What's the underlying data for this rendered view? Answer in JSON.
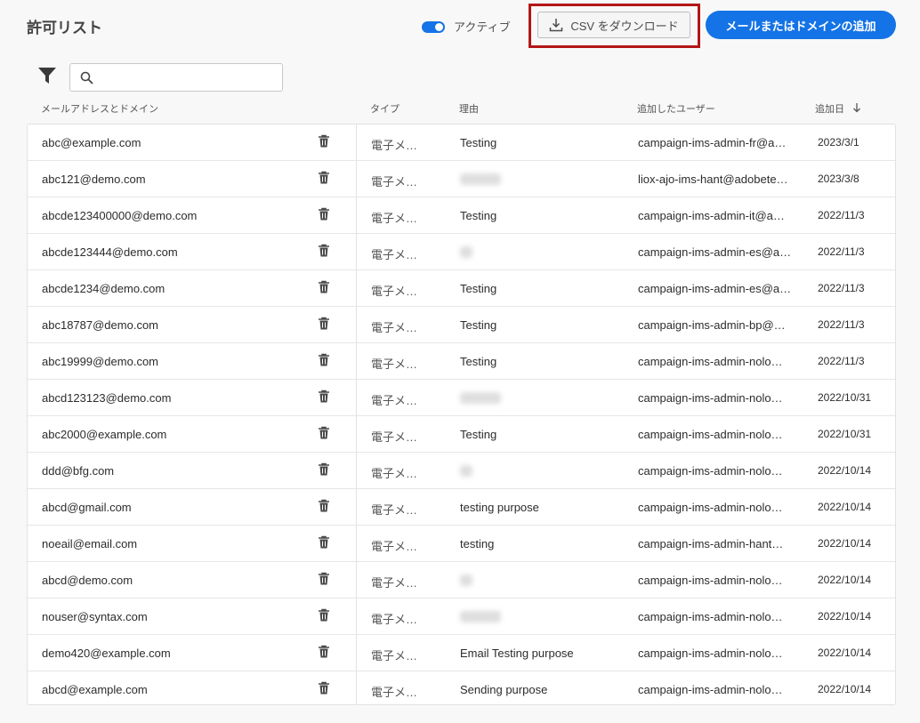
{
  "header": {
    "title": "許可リスト",
    "toggle_label": "アクティブ",
    "toggle_on": true,
    "download_label": "CSV をダウンロード",
    "add_label": "メールまたはドメインの追加"
  },
  "search": {
    "value": "",
    "placeholder": ""
  },
  "columns": {
    "email": "メールアドレスとドメイン",
    "type": "タイプ",
    "reason": "理由",
    "user": "追加したユーザー",
    "date": "追加日"
  },
  "rows": [
    {
      "email": "abc@example.com",
      "type": "電子メ…",
      "reason": "Testing",
      "user": "campaign-ims-admin-fr@a…",
      "date": "2023/3/1"
    },
    {
      "email": "abc121@demo.com",
      "type": "電子メ…",
      "reason": "",
      "user": "liox-ajo-ims-hant@adobete…",
      "date": "2023/3/8"
    },
    {
      "email": "abcde123400000@demo.com",
      "type": "電子メ…",
      "reason": "Testing",
      "user": "campaign-ims-admin-it@a…",
      "date": "2022/11/3"
    },
    {
      "email": "abcde123444@demo.com",
      "type": "電子メ…",
      "reason": "",
      "user": "campaign-ims-admin-es@a…",
      "date": "2022/11/3"
    },
    {
      "email": "abcde1234@demo.com",
      "type": "電子メ…",
      "reason": "Testing",
      "user": "campaign-ims-admin-es@a…",
      "date": "2022/11/3"
    },
    {
      "email": "abc18787@demo.com",
      "type": "電子メ…",
      "reason": "Testing",
      "user": "campaign-ims-admin-bp@…",
      "date": "2022/11/3"
    },
    {
      "email": "abc19999@demo.com",
      "type": "電子メ…",
      "reason": "Testing",
      "user": "campaign-ims-admin-nolo…",
      "date": "2022/11/3"
    },
    {
      "email": "abcd123123@demo.com",
      "type": "電子メ…",
      "reason": "",
      "user": "campaign-ims-admin-nolo…",
      "date": "2022/10/31"
    },
    {
      "email": "abc2000@example.com",
      "type": "電子メ…",
      "reason": "Testing",
      "user": "campaign-ims-admin-nolo…",
      "date": "2022/10/31"
    },
    {
      "email": "ddd@bfg.com",
      "type": "電子メ…",
      "reason": "",
      "user": "campaign-ims-admin-nolo…",
      "date": "2022/10/14"
    },
    {
      "email": "abcd@gmail.com",
      "type": "電子メ…",
      "reason": "testing purpose",
      "user": "campaign-ims-admin-nolo…",
      "date": "2022/10/14"
    },
    {
      "email": "noeail@email.com",
      "type": "電子メ…",
      "reason": "testing",
      "user": "campaign-ims-admin-hant…",
      "date": "2022/10/14"
    },
    {
      "email": "abcd@demo.com",
      "type": "電子メ…",
      "reason": "",
      "user": "campaign-ims-admin-nolo…",
      "date": "2022/10/14"
    },
    {
      "email": "nouser@syntax.com",
      "type": "電子メ…",
      "reason": "",
      "user": "campaign-ims-admin-nolo…",
      "date": "2022/10/14"
    },
    {
      "email": "demo420@example.com",
      "type": "電子メ…",
      "reason": "Email Testing purpose",
      "user": "campaign-ims-admin-nolo…",
      "date": "2022/10/14"
    },
    {
      "email": "abcd@example.com",
      "type": "電子メ…",
      "reason": "Sending purpose",
      "user": "campaign-ims-admin-nolo…",
      "date": "2022/10/14"
    }
  ],
  "colors": {
    "accent": "#1473e6",
    "highlight": "#b31616"
  }
}
